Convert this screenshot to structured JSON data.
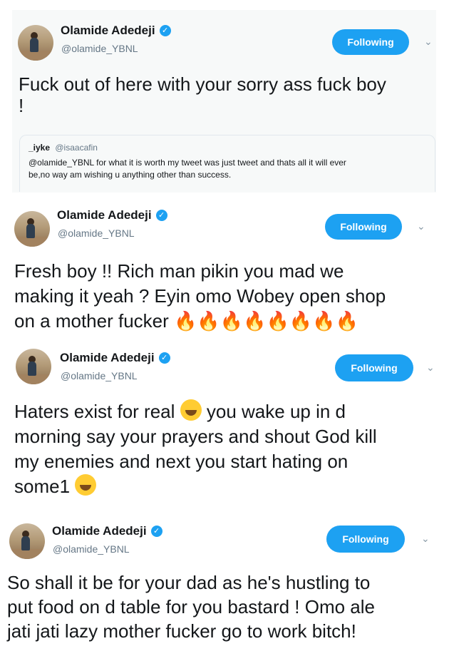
{
  "tweets": [
    {
      "name": "Olamide Adedeji",
      "handle": "@olamide_YBNL",
      "follow_label": "Following",
      "lines": [
        "Fuck out of here with your sorry ass fuck boy",
        "!"
      ],
      "quote": {
        "name": "_iyke",
        "handle": "@isaacafin",
        "lines": [
          "@olamide_YBNL for what it is worth my tweet was just tweet and thats all it will ever",
          "be,no way am wishing u anything other than success."
        ]
      }
    },
    {
      "name": "Olamide Adedeji",
      "handle": "@olamide_YBNL",
      "follow_label": "Following",
      "lines": [
        "Fresh boy !! Rich man pikin you mad we",
        "making it yeah ? Eyin omo Wobey open shop",
        "on a mother fucker"
      ],
      "emoji": "fire-emoji x8"
    },
    {
      "name": "Olamide Adedeji",
      "handle": "@olamide_YBNL",
      "follow_label": "Following",
      "lines": [
        "Haters exist for real",
        "you wake up in d",
        "morning say your prayers and shout God kill",
        "my enemies and next you start hating on",
        "some1"
      ],
      "emoji": "laughing-tears-emoji"
    },
    {
      "name": "Olamide Adedeji",
      "handle": "@olamide_YBNL",
      "follow_label": "Following",
      "lines": [
        "So shall it be for your dad as he's hustling to",
        "put food on d table for you bastard ! Omo ale",
        "jati jati lazy mother fucker go to work bitch!"
      ]
    }
  ]
}
